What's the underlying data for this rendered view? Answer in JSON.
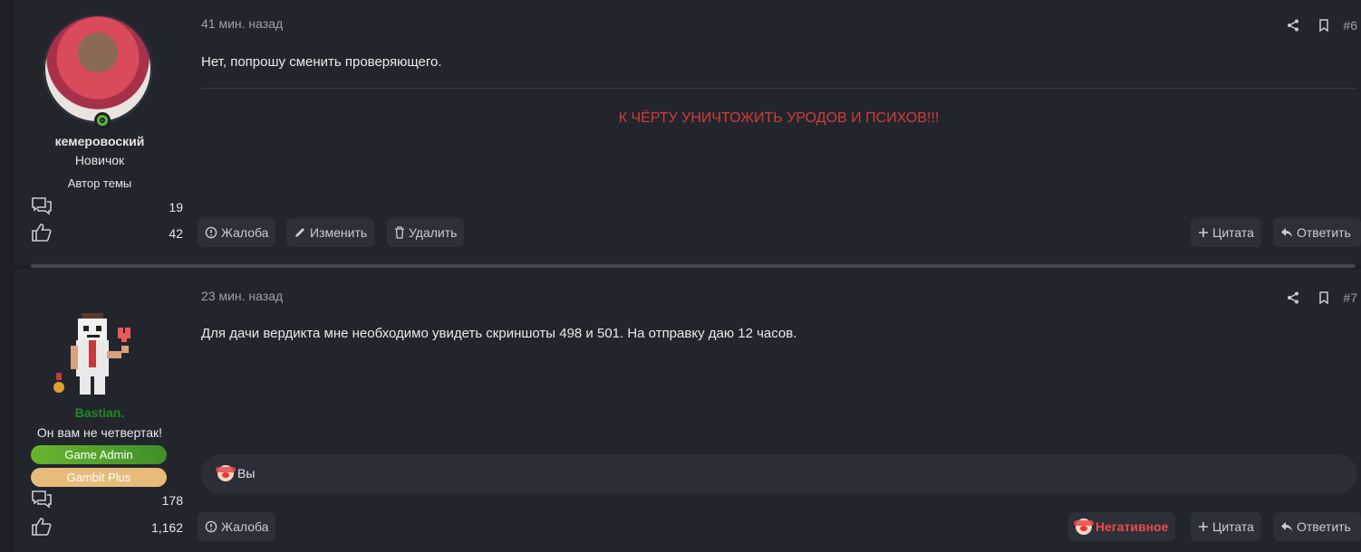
{
  "posts": [
    {
      "user": {
        "name": "кемеровоский",
        "rank": "Новичок",
        "subrank": "Автор темы",
        "messages": "19",
        "reactions": "42",
        "online": true
      },
      "time": "41 мин. назад",
      "number": "#6",
      "message": "Нет, попрошу сменить проверяющего.",
      "signature": "К ЧЁРТУ УНИЧТОЖИТЬ УРОДОВ И ПСИХОВ!!!",
      "buttons_left": [
        "Жалоба",
        "Изменить",
        "Удалить"
      ],
      "buttons_right": [
        "Цитата",
        "Ответить"
      ]
    },
    {
      "user": {
        "name": "Bastian.",
        "rank": "Он вам не четвертак!",
        "badges": [
          "Game Admin",
          "Gambit Plus"
        ],
        "messages": "178",
        "reactions": "1,162"
      },
      "time": "23 мин. назад",
      "number": "#7",
      "message": "Для дачи вердикта мне необходимо увидеть скриншоты 498 и 501. На отправку даю 12 часов.",
      "reactions_bar": "Вы",
      "reaction_label": "Негативное",
      "buttons_left": [
        "Жалоба"
      ],
      "buttons_right": [
        "Цитата",
        "Ответить"
      ]
    }
  ],
  "colors": {
    "background": "#1e2026",
    "post_bg": "#23252d",
    "signature": "#d13b3b",
    "online": "#5fb336",
    "admin_badge": "#4f9e2d",
    "plus_badge": "#e7bb79",
    "negative": "#f04848"
  }
}
